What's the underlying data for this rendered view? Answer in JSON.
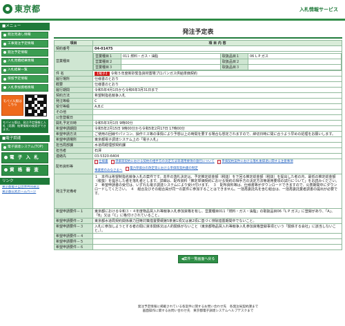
{
  "header": {
    "logo_text": "東京都",
    "service_name": "入札情報サービス"
  },
  "sidebar": {
    "menu_heading": "■メニュー",
    "items": [
      "発注見通し情報",
      "工事発注予定情報",
      "発注予定情報",
      "入札見積結果情報",
      "入札結果一覧",
      "保留予定情報",
      "入札参加資格情報"
    ],
    "mobile_label": "モバイル版はこちら",
    "mobile_note": "モバイル版は、発注予定情報と入札（見積）結果情報の検索ができます。",
    "system_heading": "■電子調達",
    "system_items": [
      "電子調達システム(TOP)"
    ],
    "big_items": [
      "電 子 入 札",
      "資 格 審 査"
    ],
    "links_heading": "リンク",
    "links": [
      "東京都電子自治体共同運営",
      "東京都公式ホームページ"
    ]
  },
  "main": {
    "title": "発注予定表",
    "col_item": "項目",
    "col_content": "項 目 内 容",
    "rows": {
      "contract_no_label": "契約番号",
      "contract_no": "04-01475",
      "business_type_label": "営業種目",
      "business_1_label": "営業種目１",
      "business_1": "011 燃料・ガス・油脂",
      "business_2_label": "営業種目２",
      "business_2": "",
      "business_3_label": "営業種目３",
      "business_3": "",
      "handling_1_label": "取扱品目１",
      "handling_1": "06 L P ガス",
      "handling_2_label": "取扱品目２",
      "handling_2": "",
      "handling_3_label": "取扱品目３",
      "handling_3": "",
      "subject_label": "件 名",
      "subject_tag": "【電子】",
      "subject": "令和５年度新砂緊急資材置場プロパンガス供給単価契約",
      "location_label": "履行場所",
      "location": "仕様書のとおり",
      "summary_label": "概要",
      "summary": "仕様書のとおり",
      "period_label": "履行期間",
      "period": "令和5年4月1日から令和6年3月31日まで",
      "method_label": "契約方法",
      "method": "希望制指名競争入札",
      "grade_label": "発注等級",
      "grade": "C",
      "accept_label": "受付等級",
      "accept": "A,B,C",
      "other_label": "その他",
      "other": "",
      "notice_date_label": "公告登載日",
      "notice_date": "",
      "open_date_label": "開札予定日時",
      "open_date": "令和5年3月1日 9時00分",
      "apply_period_label": "希望申請期間",
      "apply_period": "令和5年2月15日 9時00分から令和5年2月17日 17時00分",
      "apply_method_label": "希望申請方法",
      "apply_method": "ご使用の回線やパソコン、操作ミス等の事情により予想以上の時間を要する場合も想定されますので、締切日時に間に合うよう早めの処理をお願いします。",
      "accept_place_label": "希望申請場所",
      "accept_place": "東京都電子調達システム上の「電子入札」",
      "section_label": "担当局部課",
      "section": "水道局経理部契約課",
      "person_label": "担当者",
      "person": "石澤",
      "contact_label": "連絡先",
      "contact": "03-5320-6404",
      "docs_label": "配布資料等",
      "docs": [
        "仕様書",
        "単価等契約における契約の相手方の決定方法等運用要項の施行について",
        "単価契約案件における落札後辞退に関する注意事項",
        "事業者のみなさまへ",
        "電力単価分の改定等における単価等契約書の制定"
      ],
      "remarks_label": "発注予定備考",
      "remarks": "１　本件は希望制指名競争入札の案件です。本件の落札決定は、予定推定総金額（税抜）を下回る推定総金額（税抜）を提出した者の内、最低の推定総金額（税抜）を提示した者を落札者とします。詳細は、配布資料「推定単価契約における契約の相手方の決定方法等運用要項の試行について」をお読みください。　２　希望申請書の受付は、いずれも電子調達システムにより受け付けます。　３　配布資料等は、仕様書等がダウンロードできますので、公表期間中にダウンロードしてください。　４　組合及びその組合員が同一の案件に参加することはできません。一括再委託先を含む組合は、一括再委託業者調書の提出が必要です。",
      "req1_label": "希望申請要件－１",
      "req1": "東京都における令和３・４年度物品買入れ等競争入札参加資格を有し、営業種目011「燃料・ガス・油脂」の取扱品目06「L P ガス」に登録があり、「A」、「B」又は「C」に格付けされていること。",
      "req2_label": "希望申請要件－２",
      "req2": "東京都水道局契約関係暴力団等対策措置要綱第5条第1項又は第2項に基づく排除措置期間中でないこと。",
      "req3_label": "希望申請要件－３",
      "req3": "入札に参加しようとする者の間に資本関係又は人的関係がないこと（東京都物品買入れ等競争入札参加資格登録事項という「関係する会社」に該当しないこと。）。",
      "req4_label": "希望申請要件－４",
      "req4": "",
      "req5_label": "希望申請要件－５",
      "req5": "",
      "req6_label": "希望申請要件－６",
      "req6": ""
    },
    "list_button": "◀案件一覧画面へ戻る"
  },
  "footer": {
    "line1": "発注予定情報に掲載されている各案件に関するお問い合わせ先　各発注局契約課まで",
    "line2": "画面操作に関するお問い合わせ先　東京都電子調達システムヘルプデスクまで"
  }
}
